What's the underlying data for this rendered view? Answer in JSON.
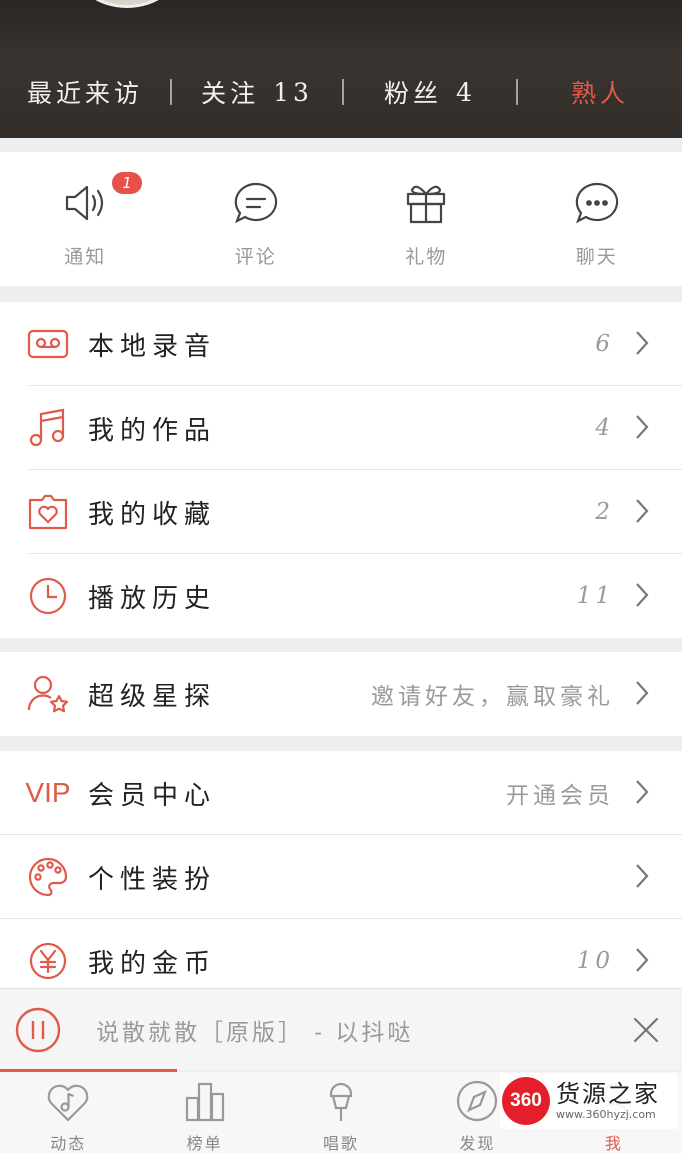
{
  "header": {
    "stats": [
      {
        "label": "最近来访",
        "num": ""
      },
      {
        "label": "关注",
        "num": "13"
      },
      {
        "label": "粉丝",
        "num": "4"
      },
      {
        "label": "熟人",
        "num": "",
        "highlight": true
      }
    ]
  },
  "actions": [
    {
      "label": "通知",
      "icon": "speaker-icon",
      "badge": "1"
    },
    {
      "label": "评论",
      "icon": "comment-icon"
    },
    {
      "label": "礼物",
      "icon": "gift-icon"
    },
    {
      "label": "聊天",
      "icon": "chat-icon"
    }
  ],
  "list_group1": [
    {
      "title": "本地录音",
      "value": "6",
      "icon": "cassette-icon"
    },
    {
      "title": "我的作品",
      "value": "4",
      "icon": "music-note-icon"
    },
    {
      "title": "我的收藏",
      "value": "2",
      "icon": "heart-folder-icon"
    },
    {
      "title": "播放历史",
      "value": "11",
      "icon": "clock-icon"
    }
  ],
  "list_group2": [
    {
      "title": "超级星探",
      "value": "邀请好友，赢取豪礼",
      "icon": "user-star-icon"
    }
  ],
  "list_group3": [
    {
      "title": "会员中心",
      "value": "开通会员",
      "icon": "vip-icon",
      "icon_text": "VIP"
    },
    {
      "title": "个性装扮",
      "value": "",
      "icon": "palette-icon"
    },
    {
      "title": "我的金币",
      "value": "10",
      "icon": "coin-icon"
    }
  ],
  "player": {
    "track": "说散就散［原版］ - 以抖哒",
    "progress": 0.26
  },
  "tabs": [
    {
      "label": "动态",
      "icon": "heart-note-icon"
    },
    {
      "label": "榜单",
      "icon": "chart-icon"
    },
    {
      "label": "唱歌",
      "icon": "microphone-icon"
    },
    {
      "label": "发现",
      "icon": "compass-icon"
    },
    {
      "label": "我",
      "icon": "user-icon",
      "active": true
    }
  ],
  "watermark": {
    "logo": "360",
    "title": "货源之家",
    "url": "www.360hyzj.com"
  },
  "colors": {
    "accent": "#e35a4b",
    "header_bg": "#332d29",
    "badge": "#e8504a"
  }
}
